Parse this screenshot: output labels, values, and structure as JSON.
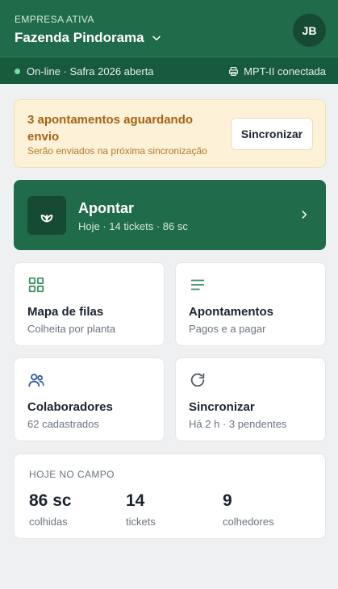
{
  "header": {
    "caption": "EMPRESA ATIVA",
    "company": "Fazenda Pindorama",
    "avatar": "JB"
  },
  "status": {
    "text": "On-line · Safra 2026 aberta",
    "printer": "MPT-II conectada"
  },
  "alert": {
    "title": "3 apontamentos aguardando envio",
    "subtitle": "Serão enviados na próxima sincronização",
    "button": "Sincronizar"
  },
  "primary": {
    "title": "Apontar",
    "subtitle": "Hoje · 14 tickets · 86 sc"
  },
  "cards": [
    {
      "title": "Mapa de filas",
      "subtitle": "Colheita por planta",
      "icon": "grid-icon"
    },
    {
      "title": "Apontamentos",
      "subtitle": "Pagos e a pagar",
      "icon": "list-icon"
    },
    {
      "title": "Colaboradores",
      "subtitle": "62 cadastrados",
      "icon": "users-icon"
    },
    {
      "title": "Sincronizar",
      "subtitle": "Há 2 h · 3 pendentes",
      "icon": "refresh-icon"
    }
  ],
  "today": {
    "caption": "HOJE NO CAMPO",
    "stats": [
      {
        "value": "86 sc",
        "label": "colhidas"
      },
      {
        "value": "14",
        "label": "tickets"
      },
      {
        "value": "9",
        "label": "colhedores"
      }
    ]
  },
  "colors": {
    "brand": "#1f6b4a",
    "brand_dark": "#174a33",
    "alert_bg": "#fdf1d8",
    "alert_text": "#a46313",
    "online": "#6ee0a0"
  }
}
